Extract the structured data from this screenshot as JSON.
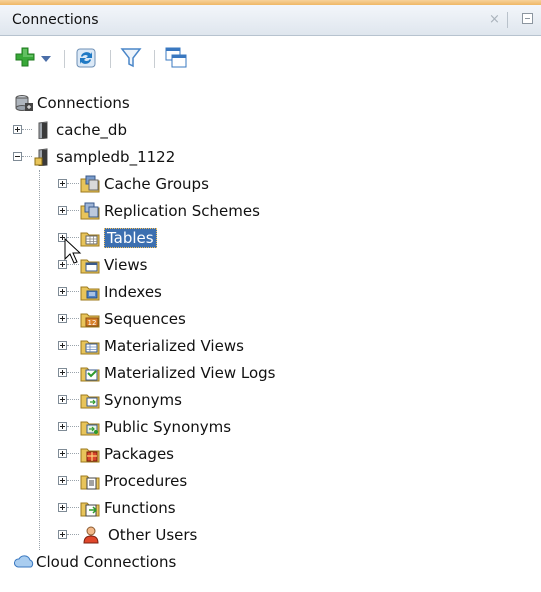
{
  "panel": {
    "title": "Connections",
    "close_glyph": "×",
    "minimize_icon": "minimize-icon"
  },
  "toolbar": {
    "buttons": [
      {
        "icon": "add-connection-icon",
        "color": "#2ea02e"
      },
      {
        "icon": "dropdown-arrow-icon",
        "color": "#4b6ea8"
      },
      {
        "icon": "refresh-icon",
        "color": "#1f79c4"
      },
      {
        "icon": "filter-icon",
        "color": "#4a86c8"
      },
      {
        "icon": "schema-browser-icon",
        "color": "#3a78c0"
      }
    ]
  },
  "tree": {
    "root_label": "Connections",
    "connections": [
      {
        "label": "cache_db",
        "expanded": false
      },
      {
        "label": "sampledb_1122",
        "expanded": true
      }
    ],
    "children": [
      {
        "label": "Cache Groups",
        "icon": "cache-groups-folder-icon"
      },
      {
        "label": "Replication Schemes",
        "icon": "replication-schemes-folder-icon"
      },
      {
        "label": "Tables",
        "icon": "tables-folder-icon",
        "selected": true
      },
      {
        "label": "Views",
        "icon": "views-folder-icon"
      },
      {
        "label": "Indexes",
        "icon": "indexes-folder-icon"
      },
      {
        "label": "Sequences",
        "icon": "sequences-folder-icon"
      },
      {
        "label": "Materialized Views",
        "icon": "materialized-views-folder-icon"
      },
      {
        "label": "Materialized View Logs",
        "icon": "materialized-view-logs-folder-icon"
      },
      {
        "label": "Synonyms",
        "icon": "synonyms-folder-icon"
      },
      {
        "label": "Public Synonyms",
        "icon": "public-synonyms-folder-icon"
      },
      {
        "label": "Packages",
        "icon": "packages-folder-icon"
      },
      {
        "label": "Procedures",
        "icon": "procedures-folder-icon"
      },
      {
        "label": "Functions",
        "icon": "functions-folder-icon"
      },
      {
        "label": "Other Users",
        "icon": "other-users-icon"
      }
    ],
    "cloud_label": "Cloud Connections"
  },
  "colors": {
    "selection": "#3c6fb0",
    "folder": "#e8c45a",
    "title_bar": "#e6ecf2",
    "accent": "#efb765"
  }
}
